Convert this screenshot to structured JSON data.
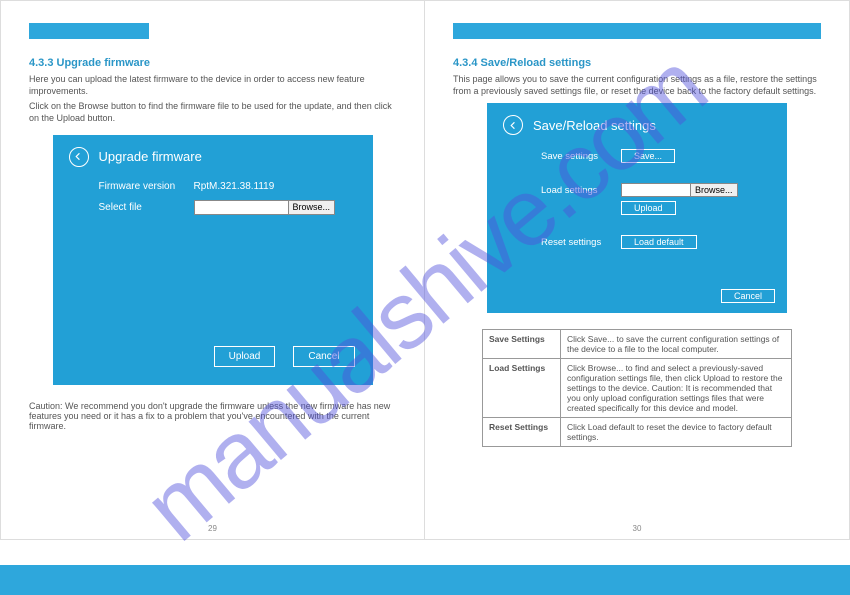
{
  "watermark": "manualshive.com",
  "left": {
    "section_num": "4.3.3 Upgrade firmware",
    "intro1": "Here you can upload the latest firmware to the device in order to access new feature improvements.",
    "intro2": "Click on the Browse button to find the firmware file to be used for the update, and then click on the Upload button.",
    "panel_title": "Upgrade firmware",
    "fw_label": "Firmware version",
    "fw_value": "RptM.321.38.1119",
    "select_label": "Select file",
    "browse": "Browse...",
    "upload": "Upload",
    "cancel": "Cancel",
    "caution": "Caution: We recommend you don't upgrade the firmware unless the new firmware has new features you need or it has a fix to a problem that you've encountered with the current firmware.",
    "page_num": "29"
  },
  "right": {
    "section_num": "4.3.4 Save/Reload settings",
    "intro": "This page allows you to save the current configuration settings as a file, restore the settings from a previously saved settings file, or reset the device back to the factory default settings.",
    "panel_title": "Save/Reload settings",
    "save_label": "Save settings",
    "save_btn": "Save...",
    "load_label": "Load settings",
    "browse": "Browse...",
    "upload_btn": "Upload",
    "reset_label": "Reset settings",
    "reset_btn": "Load default",
    "cancel": "Cancel",
    "table": {
      "r1a": "Save Settings",
      "r1b": "Click Save... to save the current configuration settings of the device to a file to the local computer.",
      "r2a": "Load Settings",
      "r2b": "Click Browse... to find and select a previously-saved configuration settings file, then click Upload to restore the settings to the device. Caution: It is recommended that you only upload configuration settings files that were created specifically for this device and model.",
      "r3a": "Reset Settings",
      "r3b": "Click Load default to reset the device to factory default settings."
    },
    "page_num": "30"
  }
}
